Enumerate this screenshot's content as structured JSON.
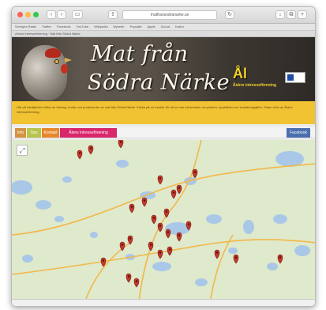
{
  "browser": {
    "address": "matfransodranarke.se",
    "bookmarks": [
      "Sveriges Radio",
      "Twitter",
      "Facebook",
      "YouTube",
      "Wikipedia",
      "Nyheter",
      "Populärt",
      "Apple",
      "iCloud",
      "Kartor"
    ],
    "tab_strip": "Ahöve intresseförening · Mat från Södra Närke"
  },
  "header": {
    "title_line1": "Mat från",
    "title_line2": "Södra Närke",
    "logo_mark": "Ål",
    "logo_subtitle": "Åsbro intresseförening"
  },
  "info": {
    "text": "Här på karttjänsten hittar du företag, bodar och producenter av mat från Södra Närke. Klicka på en markör för att se mer information om platsen, öppettider och kontaktuppgifter. Sidan drivs av Åsbro intresseförening."
  },
  "nav": {
    "items": [
      {
        "label": "Info"
      },
      {
        "label": "Tips"
      },
      {
        "label": "Kontakt"
      },
      {
        "label": "Ålens intresseförening"
      }
    ],
    "facebook": "Facebook"
  },
  "map": {
    "fullscreen_glyph": "⤢",
    "marker_color": "#c0392b",
    "water_color": "#a9c8e8",
    "road_color": "#f2b84b",
    "markers": [
      {
        "place": "m01"
      },
      {
        "place": "m02"
      },
      {
        "place": "m03"
      },
      {
        "place": "m04"
      },
      {
        "place": "m05"
      },
      {
        "place": "m06"
      },
      {
        "place": "m07"
      },
      {
        "place": "m08"
      },
      {
        "place": "m09"
      },
      {
        "place": "m10"
      },
      {
        "place": "m11"
      },
      {
        "place": "m12"
      },
      {
        "place": "m13"
      },
      {
        "place": "m14"
      },
      {
        "place": "m15"
      },
      {
        "place": "m16"
      },
      {
        "place": "m17"
      },
      {
        "place": "m18"
      },
      {
        "place": "m19"
      },
      {
        "place": "m20"
      },
      {
        "place": "m21"
      },
      {
        "place": "m22"
      },
      {
        "place": "m23"
      },
      {
        "place": "m24"
      },
      {
        "place": "m25"
      },
      {
        "place": "m26"
      }
    ]
  },
  "colors": {
    "header_bg": "#4a443c",
    "infobar_bg": "#f1c232",
    "nav_pink": "#d8276b",
    "nav_facebook": "#4a6fae"
  }
}
